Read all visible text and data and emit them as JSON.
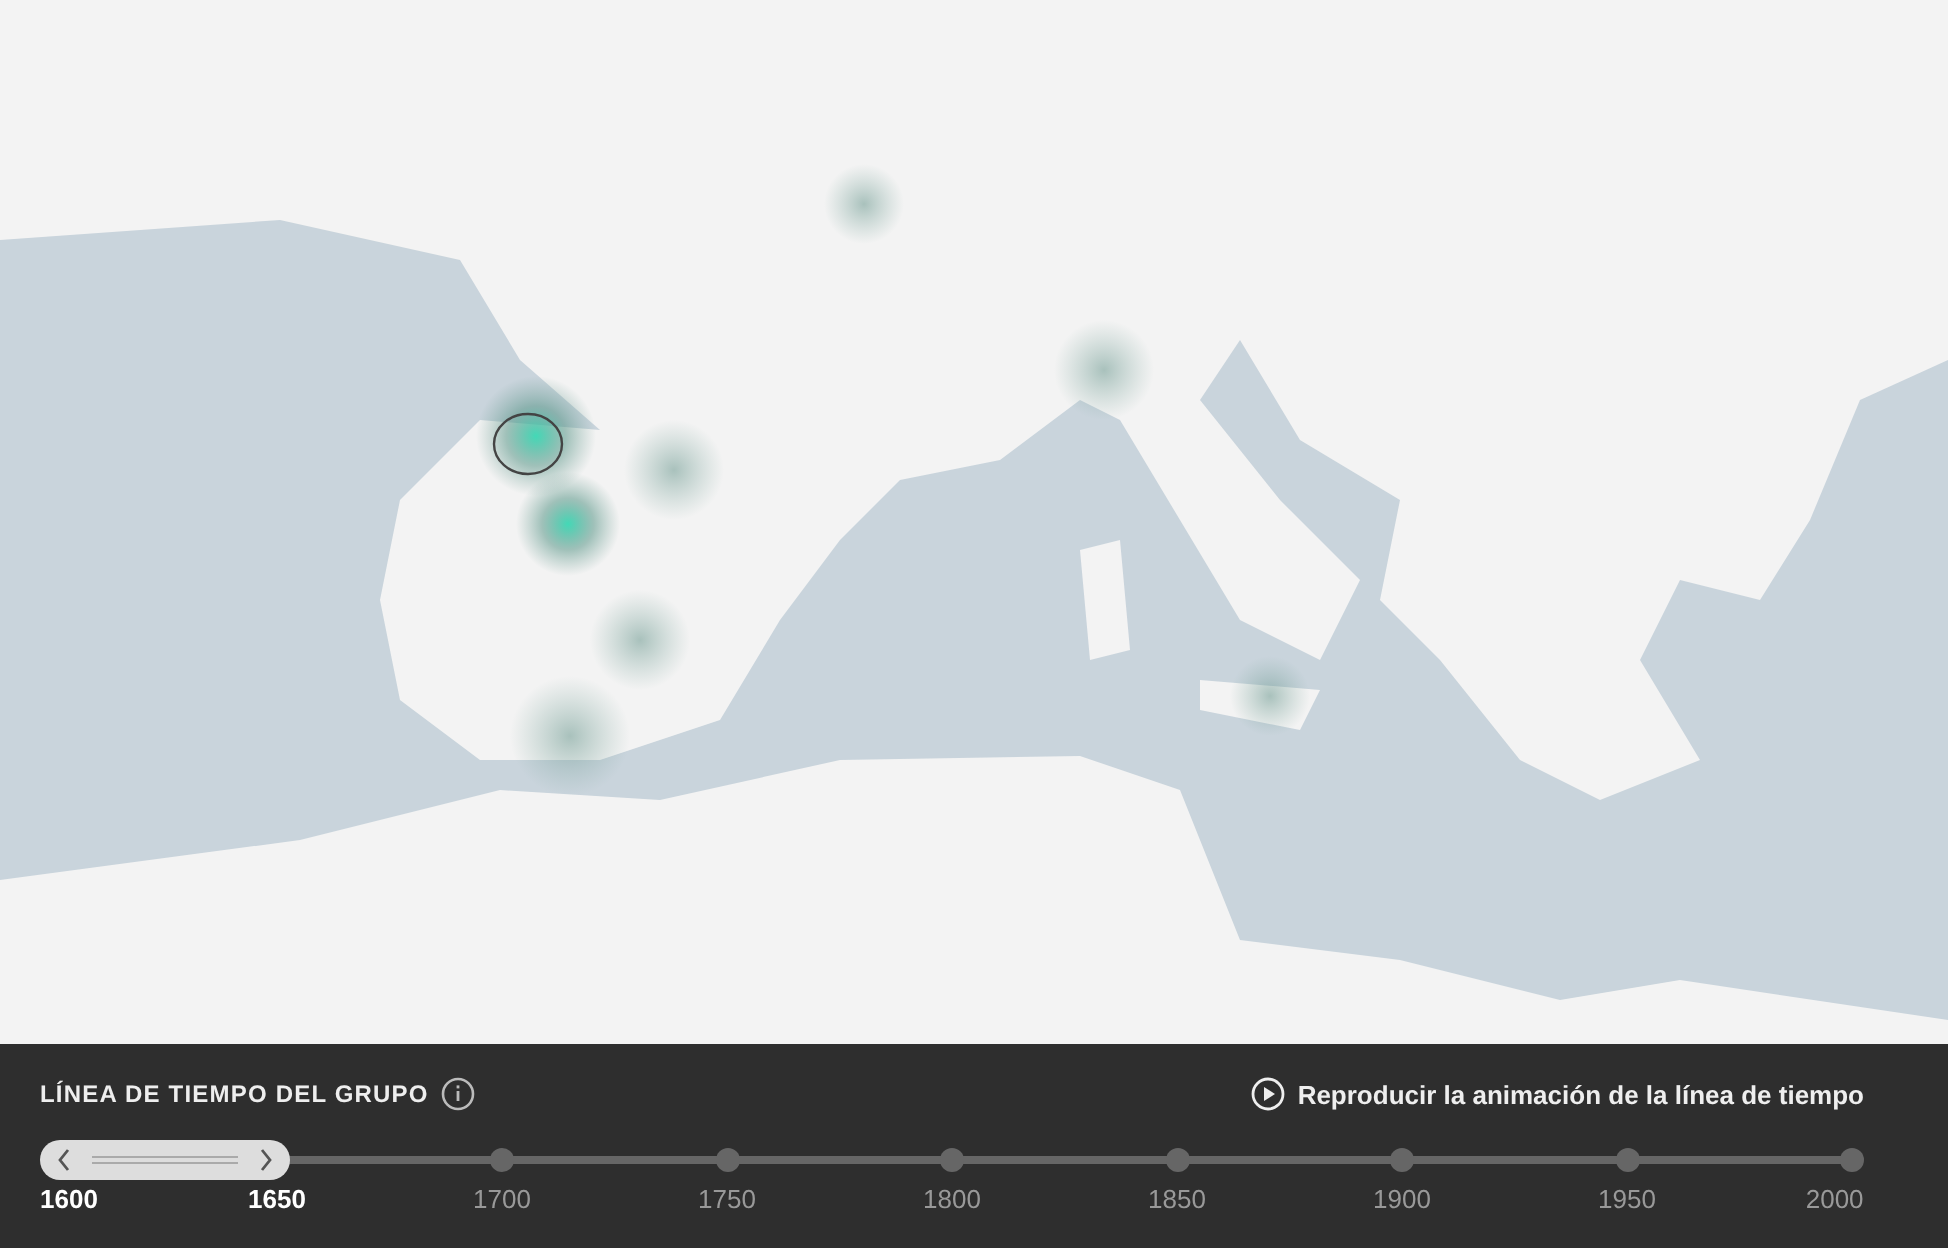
{
  "timeline": {
    "title": "LÍNEA DE TIEMPO DEL GRUPO",
    "play_label": "Reproducir la animación de la línea de tiempo",
    "ticks": [
      {
        "label": "1600",
        "selected": true
      },
      {
        "label": "1650",
        "selected": true
      },
      {
        "label": "1700",
        "selected": false
      },
      {
        "label": "1750",
        "selected": false
      },
      {
        "label": "1800",
        "selected": false
      },
      {
        "label": "1850",
        "selected": false
      },
      {
        "label": "1900",
        "selected": false
      },
      {
        "label": "1950",
        "selected": false
      },
      {
        "label": "2000",
        "selected": false
      }
    ]
  }
}
